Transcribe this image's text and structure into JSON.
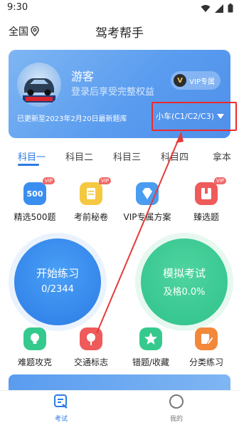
{
  "status": {
    "time": "9:30"
  },
  "header": {
    "region": "全国",
    "title": "驾考帮手"
  },
  "banner": {
    "user_name": "游客",
    "login_hint": "登录后享受完整权益",
    "vip_button": "VIP专属",
    "update_note": "已更新至2023年2月20日最新题库",
    "license_type": "小车(C1/C2/C3)"
  },
  "tabs": [
    "科目一",
    "科目二",
    "科目三",
    "科目四",
    "拿本"
  ],
  "features": [
    {
      "label": "精选500题",
      "icon_text": "500",
      "vip": "VIP"
    },
    {
      "label": "考前秘卷",
      "icon_text": "",
      "vip": "VIP"
    },
    {
      "label": "VIP专属方案",
      "icon_text": "",
      "vip": ""
    },
    {
      "label": "臻选题",
      "icon_text": "",
      "vip": "VIP"
    }
  ],
  "practice": {
    "title": "开始练习",
    "progress": "0/2344"
  },
  "exam": {
    "title": "模拟考试",
    "pass_rate": "及格0.0%"
  },
  "tools": [
    {
      "label": "难题攻克"
    },
    {
      "label": "交通标志"
    },
    {
      "label": "错题/收藏"
    },
    {
      "label": "分类练习"
    }
  ],
  "nav": [
    {
      "label": "考试"
    },
    {
      "label": "我的"
    }
  ],
  "colors": {
    "accent": "#2c7be5",
    "green": "#2fc28a",
    "annotation_red": "#ee2a2a"
  }
}
